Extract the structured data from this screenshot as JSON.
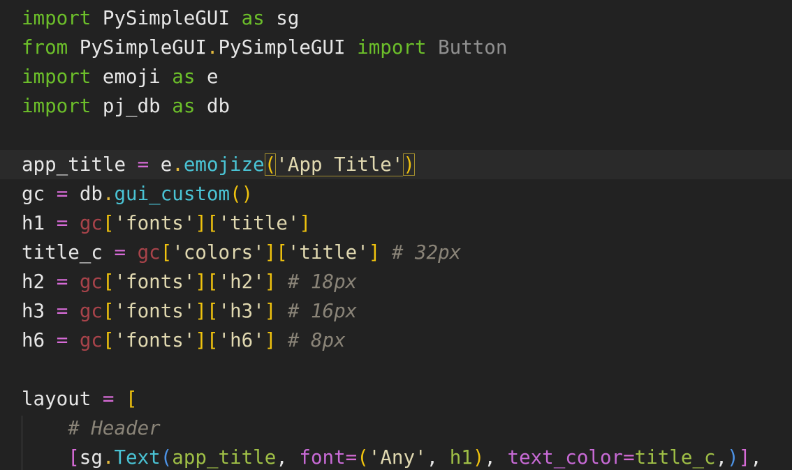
{
  "editor": {
    "theme": {
      "background": "#222222",
      "current_line": "#2a2a2a",
      "keyword": "#6cbf2a",
      "function": "#4ac3d4",
      "operator": "#d66bd6",
      "string": "#e0d8b0",
      "comment": "#8a8478",
      "bracket": "#f0c30e"
    },
    "lines": [
      {
        "kind": "import_as",
        "kw1": "import",
        "module": "PySimpleGUI",
        "kw2": "as",
        "alias": "sg"
      },
      {
        "kind": "from_import",
        "kw1": "from",
        "pkg": "PySimpleGUI",
        "dot": ".",
        "mod": "PySimpleGUI",
        "kw2": "import",
        "name": "Button"
      },
      {
        "kind": "import_as",
        "kw1": "import",
        "module": "emoji",
        "kw2": "as",
        "alias": "e"
      },
      {
        "kind": "import_as",
        "kw1": "import",
        "module": "pj_db",
        "kw2": "as",
        "alias": "db"
      },
      {
        "kind": "blank"
      },
      {
        "kind": "assign_call_str",
        "var": "app_title",
        "eq": "=",
        "obj": "e",
        "dot": ".",
        "fn": "emojize",
        "open": "(",
        "arg": "'App Title'",
        "close": ")"
      },
      {
        "kind": "assign_call",
        "var": "gc",
        "eq": "=",
        "obj": "db",
        "dot": ".",
        "fn": "gui_custom",
        "parens": "()"
      },
      {
        "kind": "assign_idx",
        "var": "h1",
        "eq": "=",
        "obj": "gc",
        "idx1": "'fonts'",
        "idx2": "'title'",
        "comment": ""
      },
      {
        "kind": "assign_idx",
        "var": "title_c",
        "eq": "=",
        "obj": "gc",
        "idx1": "'colors'",
        "idx2": "'title'",
        "comment": "# 32px"
      },
      {
        "kind": "assign_idx",
        "var": "h2",
        "eq": "=",
        "obj": "gc",
        "idx1": "'fonts'",
        "idx2": "'h2'",
        "comment": "# 18px"
      },
      {
        "kind": "assign_idx",
        "var": "h3",
        "eq": "=",
        "obj": "gc",
        "idx1": "'fonts'",
        "idx2": "'h3'",
        "comment": "# 16px"
      },
      {
        "kind": "assign_idx",
        "var": "h6",
        "eq": "=",
        "obj": "gc",
        "idx1": "'fonts'",
        "idx2": "'h6'",
        "comment": "# 8px"
      },
      {
        "kind": "blank"
      },
      {
        "kind": "assign_open",
        "var": "layout",
        "eq": "=",
        "open": "["
      },
      {
        "kind": "comment_indented",
        "indent": "    ",
        "comment": "# Header"
      },
      {
        "kind": "text_row",
        "indent": "    ",
        "open": "[",
        "obj": "sg",
        "dot": ".",
        "fn": "Text",
        "paren": "(",
        "arg1": "app_title",
        "comma1": ", ",
        "kw": "font",
        "eq": "=",
        "tuple_open": "(",
        "str": "'Any'",
        "comma2": ", ",
        "arg2": "h1",
        "tuple_close": ")",
        "comma3": ", ",
        "kw2": "text_color",
        "eq2": "=",
        "arg3": "title_c",
        "trail": ",",
        "paren_close": ")",
        "close": "]",
        "end": ","
      }
    ]
  }
}
